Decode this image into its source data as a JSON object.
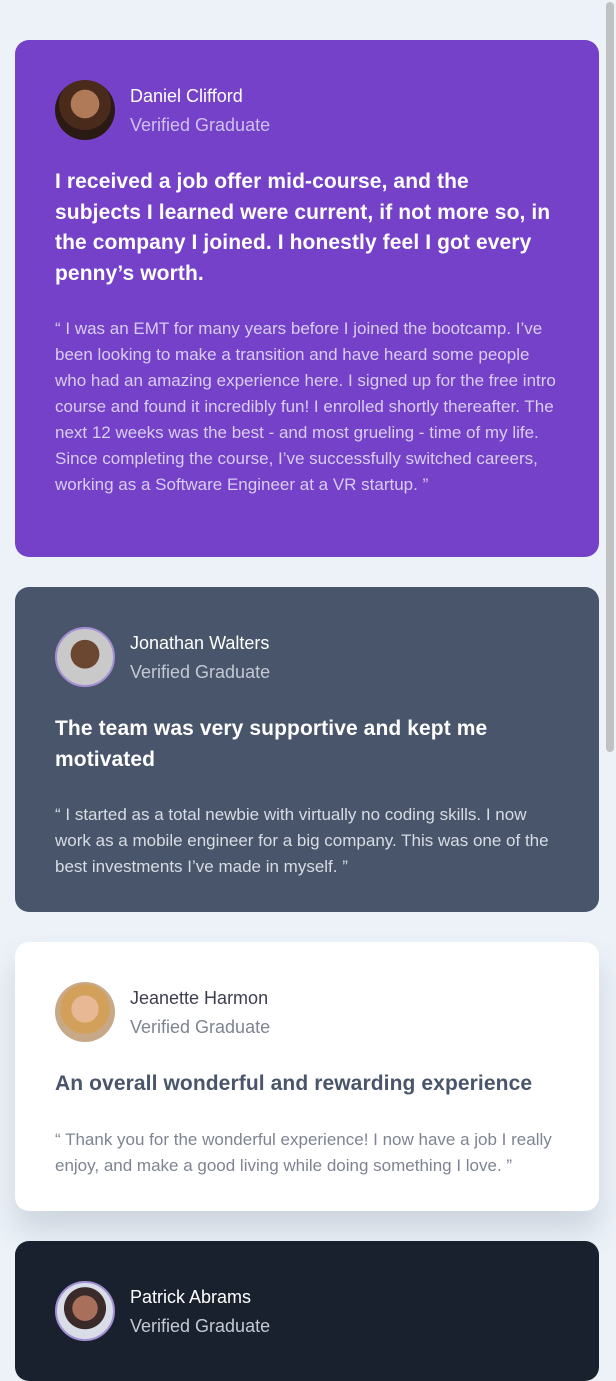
{
  "testimonials": [
    {
      "name": "Daniel Clifford",
      "role": "Verified Graduate",
      "headline": "I received a job offer mid-course, and the subjects I learned were current, if not more so, in the company I joined. I honestly feel I got every penny’s worth.",
      "quote": "“ I was an EMT for many years before I joined the bootcamp. I’ve been looking to make a transition and have heard some people who had an amazing experience here. I signed up for the free intro course and found it incredibly fun! I enrolled shortly thereafter. The next 12 weeks was the best - and most grueling - time of my life. Since completing the course, I’ve successfully switched careers, working as a Software Engineer at a VR startup. ”",
      "bg_color": "#7541C8"
    },
    {
      "name": "Jonathan Walters",
      "role": "Verified Graduate",
      "headline": "The team was very supportive and kept me motivated",
      "quote": "“ I started as a total newbie with virtually no coding skills. I now work as a mobile engineer for a big company. This was one of the best investments I’ve made in myself. ”",
      "bg_color": "#48556A"
    },
    {
      "name": "Jeanette Harmon",
      "role": "Verified Graduate",
      "headline": "An overall wonderful and rewarding experience",
      "quote": "“ Thank you for the wonderful experience! I now have a job I really enjoy, and make a good living while doing something I love. ”",
      "bg_color": "#FFFFFF"
    },
    {
      "name": "Patrick Abrams",
      "role": "Verified Graduate",
      "bg_color": "#19212E"
    }
  ],
  "page_background": "#ECF2F8"
}
